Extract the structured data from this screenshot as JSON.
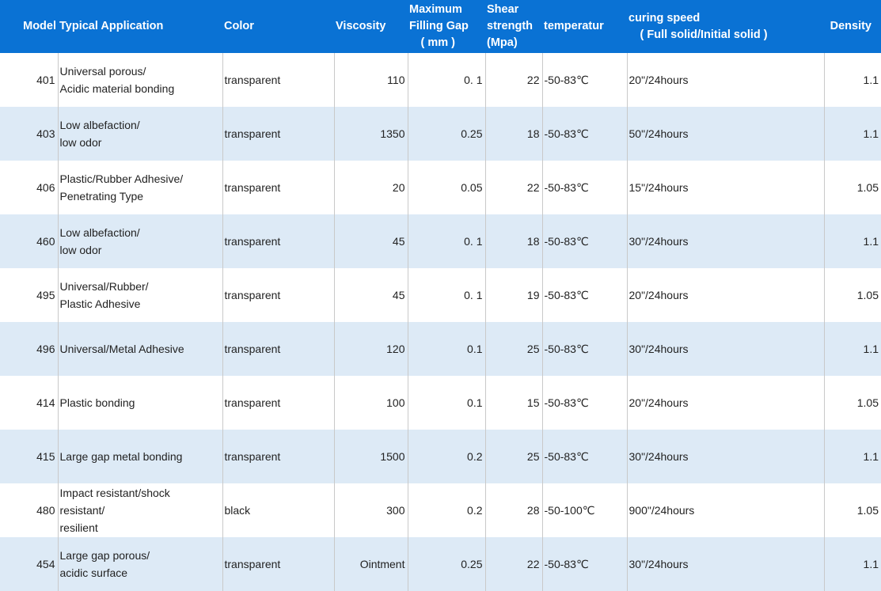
{
  "headers": {
    "model": "Model",
    "application": "Typical Application",
    "color": "Color",
    "viscosity": "Viscosity",
    "gap": "Maximum\nFilling Gap\n　( mm )",
    "shear": "Shear\nstrength\n(Mpa)",
    "temperature": "temperatur",
    "curing": "curing speed\n　( Full solid/Initial solid )",
    "density": "Density"
  },
  "rows": [
    {
      "model": "401",
      "application": "Universal porous/\nAcidic material bonding",
      "color": "transparent",
      "viscosity": "110",
      "gap": "0. 1",
      "shear": "22",
      "temperature": "-50-83℃",
      "curing": "20\"/24hours",
      "density": "1.1"
    },
    {
      "model": "403",
      "application": "Low albefaction/\nlow odor",
      "color": "transparent",
      "viscosity": "1350",
      "gap": "0.25",
      "shear": "18",
      "temperature": "-50-83℃",
      "curing": "50\"/24hours",
      "density": "1.1"
    },
    {
      "model": "406",
      "application": "Plastic/Rubber Adhesive/\nPenetrating Type",
      "color": "transparent",
      "viscosity": "20",
      "gap": "0.05",
      "shear": "22",
      "temperature": "-50-83℃",
      "curing": "15\"/24hours",
      "density": "1.05"
    },
    {
      "model": "460",
      "application": "Low albefaction/\nlow odor",
      "color": "transparent",
      "viscosity": "45",
      "gap": "0. 1",
      "shear": "18",
      "temperature": "-50-83℃",
      "curing": "30\"/24hours",
      "density": "1.1"
    },
    {
      "model": "495",
      "application": "Universal/Rubber/\nPlastic Adhesive",
      "color": "transparent",
      "viscosity": "45",
      "gap": "0. 1",
      "shear": "19",
      "temperature": "-50-83℃",
      "curing": "20\"/24hours",
      "density": "1.05"
    },
    {
      "model": "496",
      "application": "Universal/Metal Adhesive",
      "color": "transparent",
      "viscosity": "120",
      "gap": "0.1",
      "shear": "25",
      "temperature": "-50-83℃",
      "curing": "30\"/24hours",
      "density": "1.1"
    },
    {
      "model": "414",
      "application": "Plastic bonding",
      "color": "transparent",
      "viscosity": "100",
      "gap": "0.1",
      "shear": "15",
      "temperature": "-50-83℃",
      "curing": "20\"/24hours",
      "density": "1.05"
    },
    {
      "model": "415",
      "application": "Large gap metal bonding",
      "color": "transparent",
      "viscosity": "1500",
      "gap": "0.2",
      "shear": "25",
      "temperature": "-50-83℃",
      "curing": "30\"/24hours",
      "density": "1.1"
    },
    {
      "model": "480",
      "application": "Impact resistant/shock\nresistant/\nresilient",
      "color": "black",
      "viscosity": "300",
      "gap": "0.2",
      "shear": "28",
      "temperature": "-50-100℃",
      "curing": "900\"/24hours",
      "density": "1.05"
    },
    {
      "model": "454",
      "application": "Large gap porous/\nacidic surface",
      "color": "transparent",
      "viscosity": "Ointment",
      "gap": "0.25",
      "shear": "22",
      "temperature": "-50-83℃",
      "curing": "30\"/24hours",
      "density": "1.1"
    }
  ]
}
